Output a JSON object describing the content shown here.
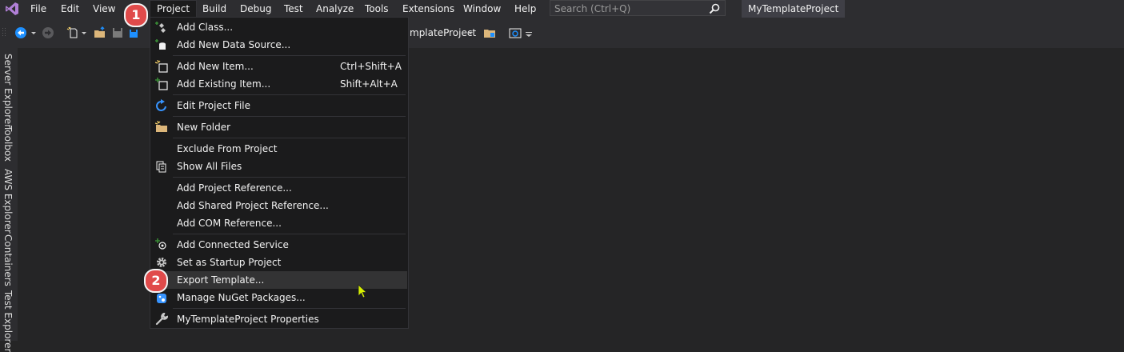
{
  "menubar": {
    "items": [
      "File",
      "Edit",
      "View",
      "Project",
      "Build",
      "Debug",
      "Test",
      "Analyze",
      "Tools",
      "Extensions",
      "Window",
      "Help"
    ],
    "search_placeholder": "Search (Ctrl+Q)",
    "project_title": "MyTemplateProject"
  },
  "toolbar": {
    "startup_project": "mplateProject"
  },
  "sidebar": {
    "tabs": [
      "Server Explorer",
      "Toolbox",
      "AWS Explorer",
      "Containers",
      "Test Explorer"
    ]
  },
  "project_menu": {
    "items": [
      {
        "label": "Add Class...",
        "shortcut": "",
        "icon": "add-class-icon"
      },
      {
        "label": "Add New Data Source...",
        "shortcut": "",
        "icon": "data-source-icon"
      },
      {
        "label": "Add New Item...",
        "shortcut": "Ctrl+Shift+A",
        "icon": "new-item-icon"
      },
      {
        "label": "Add Existing Item...",
        "shortcut": "Shift+Alt+A",
        "icon": "existing-item-icon"
      },
      {
        "label": "Edit Project File",
        "shortcut": "",
        "icon": "edit-project-icon"
      },
      {
        "label": "New Folder",
        "shortcut": "",
        "icon": "new-folder-icon"
      },
      {
        "label": "Exclude From Project",
        "shortcut": "",
        "icon": ""
      },
      {
        "label": "Show All Files",
        "shortcut": "",
        "icon": "show-all-files-icon"
      },
      {
        "label": "Add Project Reference...",
        "shortcut": "",
        "icon": ""
      },
      {
        "label": "Add Shared Project Reference...",
        "shortcut": "",
        "icon": ""
      },
      {
        "label": "Add COM Reference...",
        "shortcut": "",
        "icon": ""
      },
      {
        "label": "Add Connected Service",
        "shortcut": "",
        "icon": "connected-service-icon"
      },
      {
        "label": "Set as Startup Project",
        "shortcut": "",
        "icon": "gear-icon"
      },
      {
        "label": "Export Template...",
        "shortcut": "",
        "icon": ""
      },
      {
        "label": "Manage NuGet Packages...",
        "shortcut": "",
        "icon": "nuget-icon"
      },
      {
        "label": "MyTemplateProject Properties",
        "shortcut": "",
        "icon": "wrench-icon"
      }
    ]
  },
  "badges": {
    "step1": "1",
    "step2": "2"
  },
  "colors": {
    "badge": "#e04a4a",
    "background": "#252526",
    "menu": "#1b1b1c"
  }
}
